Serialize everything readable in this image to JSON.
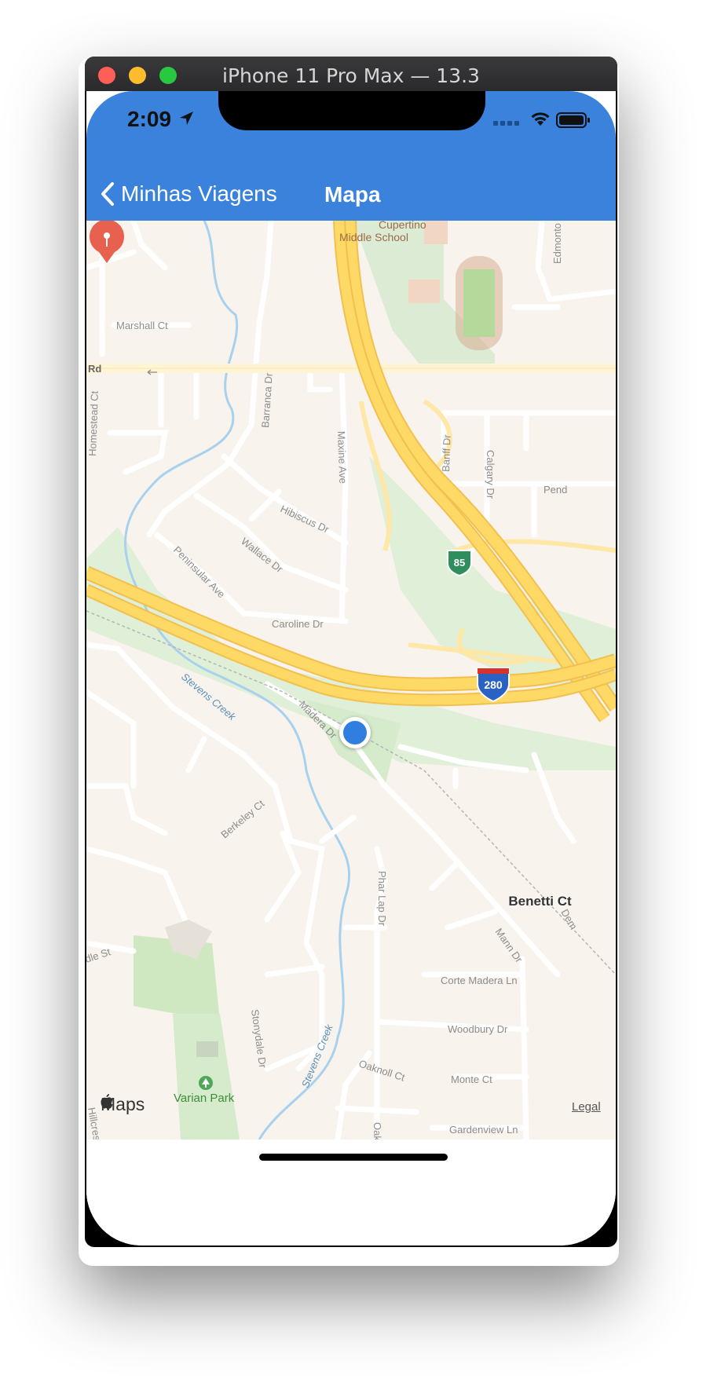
{
  "window": {
    "title": "iPhone 11 Pro Max — 13.3",
    "traffic_lights": {
      "close": "#ff5f57",
      "minimize": "#febc2e",
      "zoom": "#28c840"
    }
  },
  "status_bar": {
    "time": "2:09",
    "icons": [
      "location-arrow-icon",
      "cellular-signal-icon",
      "wifi-icon",
      "battery-icon"
    ]
  },
  "nav_bar": {
    "back_label": "Minhas Viagens",
    "title": "Mapa",
    "color": "#3a82db"
  },
  "map": {
    "attribution": "Maps",
    "legal": "Legal",
    "pin_label": "Benetti Ct",
    "pin_color": "#e8614f",
    "user_location_color": "#2f7ee0",
    "labels": {
      "cupertino_middle_school_1": "Cupertino",
      "cupertino_middle_school_2": "Middle School",
      "edmonton": "Edmonto",
      "marshall_ct": "Marshall Ct",
      "rd": "Rd",
      "homestead_ct": "Homestead Ct",
      "barranca_dr": "Barranca Dr",
      "maxine_ave": "Maxine Ave",
      "banff_dr": "Banff Dr",
      "calgary_dr": "Calgary Dr",
      "pend": "Pend",
      "hibiscus_dr": "Hibiscus Dr",
      "wallace_dr": "Wallace Dr",
      "peninsular_ave": "Peninsular Ave",
      "caroline_dr": "Caroline Dr",
      "hwy85": "85",
      "i280": "280",
      "stevens_creek_1": "Stevens Creek",
      "madera_dr": "Madera Dr",
      "berkeley_ct": "Berkeley Ct",
      "dle_st": "dle St",
      "pillar_lap_dr": "Phar Lap Dr",
      "mann_dr": "Mann Dr",
      "dem": "Dem",
      "corte_madera_ln": "Corte Madera Ln",
      "woodbury_dr": "Woodbury Dr",
      "stonydale_dr": "Stonydale Dr",
      "stevens_creek_2": "Stevens Creek",
      "oaknoll_ct": "Oaknoll Ct",
      "monte_ct": "Monte Ct",
      "varian_park": "Varian Park",
      "gardenview_ln": "Gardenview Ln",
      "oak": "Oak",
      "hillcrest_rd": "Hillcrest Rd"
    }
  }
}
